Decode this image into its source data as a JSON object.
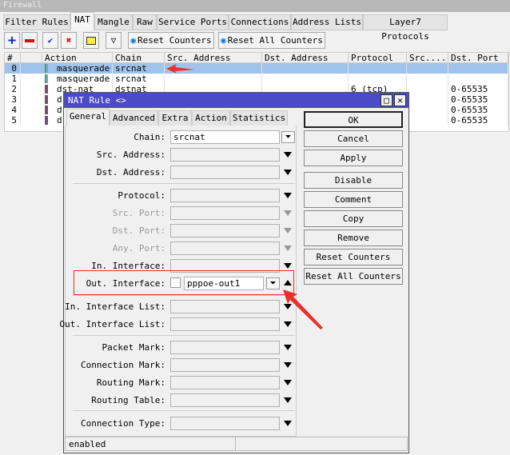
{
  "window": {
    "title": "Firewall"
  },
  "tabs": [
    "Filter Rules",
    "NAT",
    "Mangle",
    "Raw",
    "Service Ports",
    "Connections",
    "Address Lists",
    "Layer7 Protocols"
  ],
  "toolbar": {
    "add": "add-icon",
    "remove": "remove-icon",
    "enable": "check-icon",
    "disable": "x-icon",
    "comment": "note-icon",
    "filter": "filter-icon",
    "reset_counters": "Reset Counters",
    "reset_all_counters": "Reset All Counters"
  },
  "table": {
    "columns": [
      "#",
      "",
      "Action",
      "Chain",
      "Src. Address",
      "Dst. Address",
      "Protocol",
      "Src....",
      "Dst. Port"
    ],
    "rows": [
      {
        "num": "0",
        "action": "masquerade",
        "chain": "srcnat",
        "protocol": "",
        "dst_port": ""
      },
      {
        "num": "1",
        "action": "masquerade",
        "chain": "srcnat",
        "protocol": "",
        "dst_port": ""
      },
      {
        "num": "2",
        "action": "dst-nat",
        "chain": "dstnat",
        "protocol": "6 (tcp)",
        "dst_port": "0-65535"
      },
      {
        "num": "3",
        "action": "d",
        "chain": "",
        "protocol": "",
        "dst_port": "0-65535"
      },
      {
        "num": "4",
        "action": "d",
        "chain": "",
        "protocol": "",
        "dst_port": "0-65535"
      },
      {
        "num": "5",
        "action": "d",
        "chain": "",
        "protocol": "",
        "dst_port": "0-65535"
      }
    ]
  },
  "dialog": {
    "title": "NAT Rule <>",
    "tabs": [
      "General",
      "Advanced",
      "Extra",
      "Action",
      "Statistics"
    ],
    "fields": {
      "chain_label": "Chain:",
      "chain_value": "srcnat",
      "src_address": "Src. Address:",
      "dst_address": "Dst. Address:",
      "protocol": "Protocol:",
      "src_port": "Src. Port:",
      "dst_port": "Dst. Port:",
      "any_port": "Any. Port:",
      "in_interface": "In. Interface:",
      "out_interface_label": "Out. Interface:",
      "out_interface_value": "pppoe-out1",
      "in_interface_list": "In. Interface List:",
      "out_interface_list": "Out. Interface List:",
      "packet_mark": "Packet Mark:",
      "connection_mark": "Connection Mark:",
      "routing_mark": "Routing Mark:",
      "routing_table": "Routing Table:",
      "connection_type": "Connection Type:"
    },
    "buttons": [
      "OK",
      "Cancel",
      "Apply",
      "Disable",
      "Comment",
      "Copy",
      "Remove",
      "Reset Counters",
      "Reset All Counters"
    ],
    "status": "enabled"
  },
  "colors": {
    "dialog_title": "#4b4bc8",
    "selected_row": "#9fc3ea",
    "annotation": "#e8302c"
  }
}
